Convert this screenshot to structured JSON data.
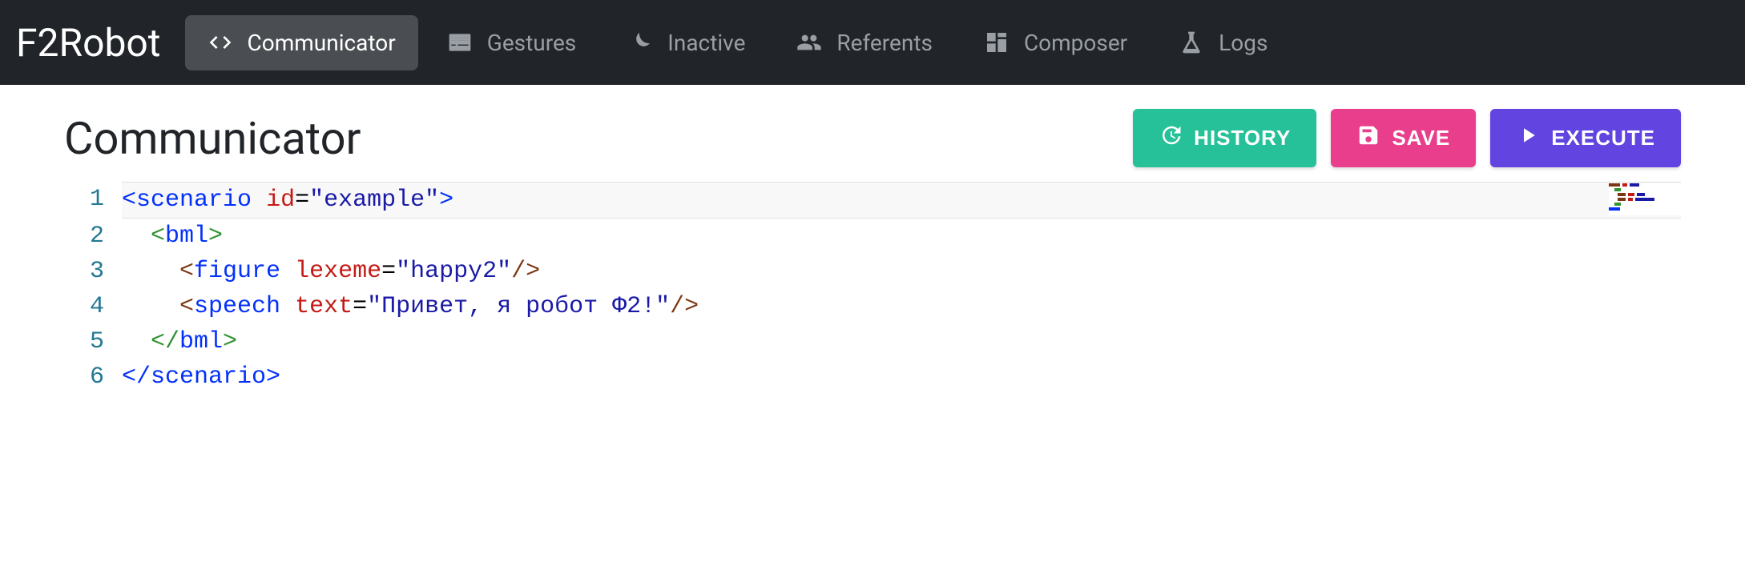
{
  "brand": "F2Robot",
  "nav": [
    {
      "label": "Communicator",
      "icon": "code-icon",
      "active": true
    },
    {
      "label": "Gestures",
      "icon": "list-icon",
      "active": false
    },
    {
      "label": "Inactive",
      "icon": "moon-icon",
      "active": false
    },
    {
      "label": "Referents",
      "icon": "users-icon",
      "active": false
    },
    {
      "label": "Composer",
      "icon": "grid-icon",
      "active": false
    },
    {
      "label": "Logs",
      "icon": "flask-icon",
      "active": false
    }
  ],
  "page": {
    "title": "Communicator"
  },
  "actions": {
    "history": "HISTORY",
    "save": "SAVE",
    "execute": "EXECUTE"
  },
  "editor": {
    "lines": [
      {
        "n": 1,
        "indent": 0,
        "parts": [
          {
            "t": "<",
            "c": "tok-bracket"
          },
          {
            "t": "scenario",
            "c": "tok-tag"
          },
          {
            "t": " "
          },
          {
            "t": "id",
            "c": "tok-attr"
          },
          {
            "t": "=",
            "c": "tok-eq"
          },
          {
            "t": "\"example\"",
            "c": "tok-string"
          },
          {
            "t": ">",
            "c": "tok-bracket"
          }
        ]
      },
      {
        "n": 2,
        "indent": 1,
        "parts": [
          {
            "t": "<",
            "c": "tok-brkt2"
          },
          {
            "t": "bml",
            "c": "tok-tag"
          },
          {
            "t": ">",
            "c": "tok-brkt2"
          }
        ]
      },
      {
        "n": 3,
        "indent": 2,
        "parts": [
          {
            "t": "<",
            "c": "tok-brkt3"
          },
          {
            "t": "figure",
            "c": "tok-tag"
          },
          {
            "t": " "
          },
          {
            "t": "lexeme",
            "c": "tok-attr"
          },
          {
            "t": "=",
            "c": "tok-eq"
          },
          {
            "t": "\"happy2\"",
            "c": "tok-string"
          },
          {
            "t": "/>",
            "c": "tok-brkt3"
          }
        ]
      },
      {
        "n": 4,
        "indent": 2,
        "parts": [
          {
            "t": "<",
            "c": "tok-brkt3"
          },
          {
            "t": "speech",
            "c": "tok-tag"
          },
          {
            "t": " "
          },
          {
            "t": "text",
            "c": "tok-attr"
          },
          {
            "t": "=",
            "c": "tok-eq"
          },
          {
            "t": "\"Привет, я робот Ф2!\"",
            "c": "tok-string"
          },
          {
            "t": "/>",
            "c": "tok-brkt3"
          }
        ]
      },
      {
        "n": 5,
        "indent": 1,
        "parts": [
          {
            "t": "</",
            "c": "tok-brkt2"
          },
          {
            "t": "bml",
            "c": "tok-tag"
          },
          {
            "t": ">",
            "c": "tok-brkt2"
          }
        ]
      },
      {
        "n": 6,
        "indent": 0,
        "parts": [
          {
            "t": "</",
            "c": "tok-bracket"
          },
          {
            "t": "scenario",
            "c": "tok-tag"
          },
          {
            "t": ">",
            "c": "tok-bracket"
          }
        ]
      }
    ]
  },
  "colors": {
    "navbar": "#212529",
    "history": "#26c198",
    "save": "#e83e8c",
    "execute": "#6244e0"
  }
}
